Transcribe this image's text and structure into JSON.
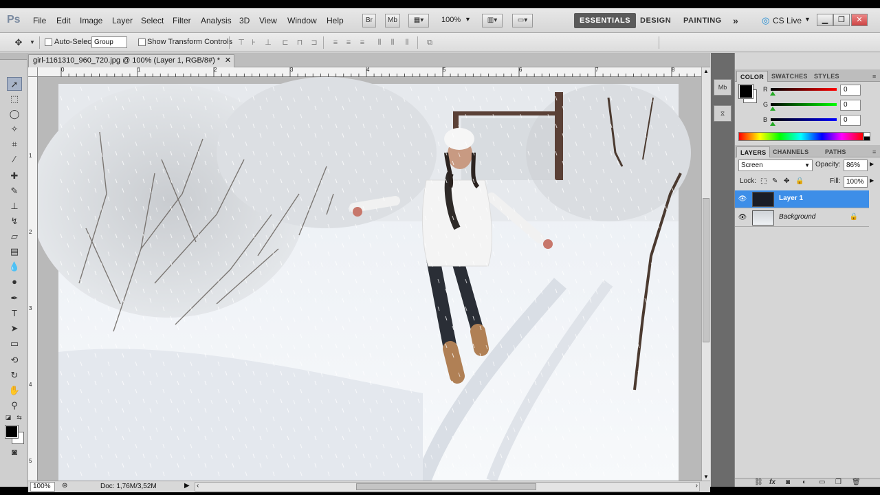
{
  "app": {
    "logo": "Ps"
  },
  "menu": [
    "File",
    "Edit",
    "Image",
    "Layer",
    "Select",
    "Filter",
    "Analysis",
    "3D",
    "View",
    "Window",
    "Help"
  ],
  "appbar": {
    "bridge": "Br",
    "minibridge": "Mb",
    "zoom": "100%"
  },
  "workspaces": [
    "ESSENTIALS",
    "DESIGN",
    "PAINTING"
  ],
  "cs_live": "CS Live",
  "options": {
    "auto_select_label": "Auto-Select:",
    "auto_select_value": "Group",
    "transform_label": "Show Transform Controls"
  },
  "document": {
    "tab_title": "girl-1161310_960_720.jpg @ 100% (Layer 1, RGB/8#) *",
    "ruler_top": [
      "0",
      "1",
      "2",
      "3",
      "4",
      "5",
      "6",
      "7",
      "8"
    ],
    "ruler_left": [
      "1",
      "2",
      "3",
      "4",
      "5"
    ],
    "zoom": "100%",
    "doc_info": "Doc: 1,76M/3,52M"
  },
  "color_panel": {
    "tabs": [
      "COLOR",
      "SWATCHES",
      "STYLES"
    ],
    "channels": [
      {
        "label": "R",
        "value": "0",
        "color": "#d40000"
      },
      {
        "label": "G",
        "value": "0",
        "color": "#00b400"
      },
      {
        "label": "B",
        "value": "0",
        "color": "#0000d4"
      }
    ]
  },
  "layers_panel": {
    "tabs": [
      "LAYERS",
      "CHANNELS",
      "PATHS"
    ],
    "blend_mode": "Screen",
    "opacity_label": "Opacity:",
    "opacity": "86%",
    "lock_label": "Lock:",
    "fill_label": "Fill:",
    "fill": "100%",
    "layers": [
      {
        "name": "Layer 1",
        "selected": true
      },
      {
        "name": "Background",
        "selected": false
      }
    ]
  }
}
